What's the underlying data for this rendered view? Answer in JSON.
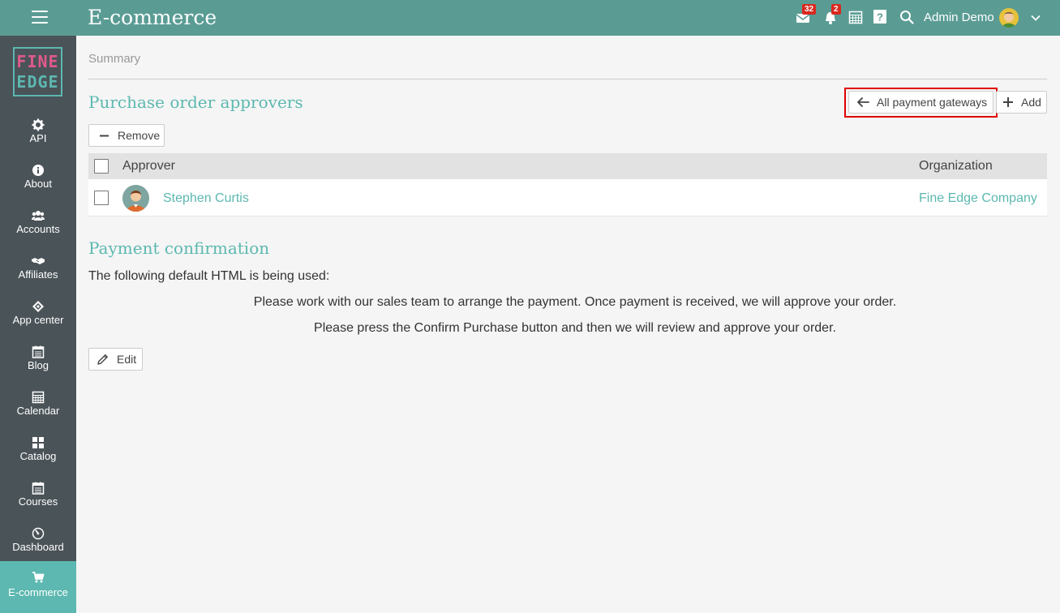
{
  "header": {
    "title": "E-commerce",
    "mail_badge": "32",
    "notifications_badge": "2",
    "user_name": "Admin Demo"
  },
  "sidebar": {
    "logo_line1": "FINE",
    "logo_line2": "EDGE",
    "items": [
      {
        "label": "API",
        "icon": "gear-icon"
      },
      {
        "label": "About",
        "icon": "info-icon"
      },
      {
        "label": "Accounts",
        "icon": "users-icon"
      },
      {
        "label": "Affiliates",
        "icon": "handshake-icon"
      },
      {
        "label": "App center",
        "icon": "diamond-icon"
      },
      {
        "label": "Blog",
        "icon": "blog-icon"
      },
      {
        "label": "Calendar",
        "icon": "calendar-icon"
      },
      {
        "label": "Catalog",
        "icon": "grid-icon"
      },
      {
        "label": "Courses",
        "icon": "courses-icon"
      },
      {
        "label": "Dashboard",
        "icon": "dashboard-icon"
      },
      {
        "label": "E-commerce",
        "icon": "cart-icon",
        "active": true
      }
    ]
  },
  "main": {
    "breadcrumb": "Summary",
    "approvers": {
      "title": "Purchase order approvers",
      "all_gateways_label": "All payment gateways",
      "add_label": "Add",
      "remove_label": "Remove",
      "columns": [
        "Approver",
        "Organization"
      ],
      "rows": [
        {
          "approver": "Stephen Curtis",
          "organization": "Fine Edge Company"
        }
      ]
    },
    "payment": {
      "title": "Payment confirmation",
      "intro": "The following default HTML is being used:",
      "line1": "Please work with our sales team to arrange the payment. Once payment is received, we will approve your order.",
      "line2": "Please press the Confirm Purchase button and then we will review and approve your order.",
      "edit_label": "Edit"
    }
  },
  "colors": {
    "topbar": "#5a9c94",
    "sidebar": "#4a5358",
    "accent": "#5cb8b0",
    "badge": "#d9291f",
    "highlight": "#e10000"
  }
}
